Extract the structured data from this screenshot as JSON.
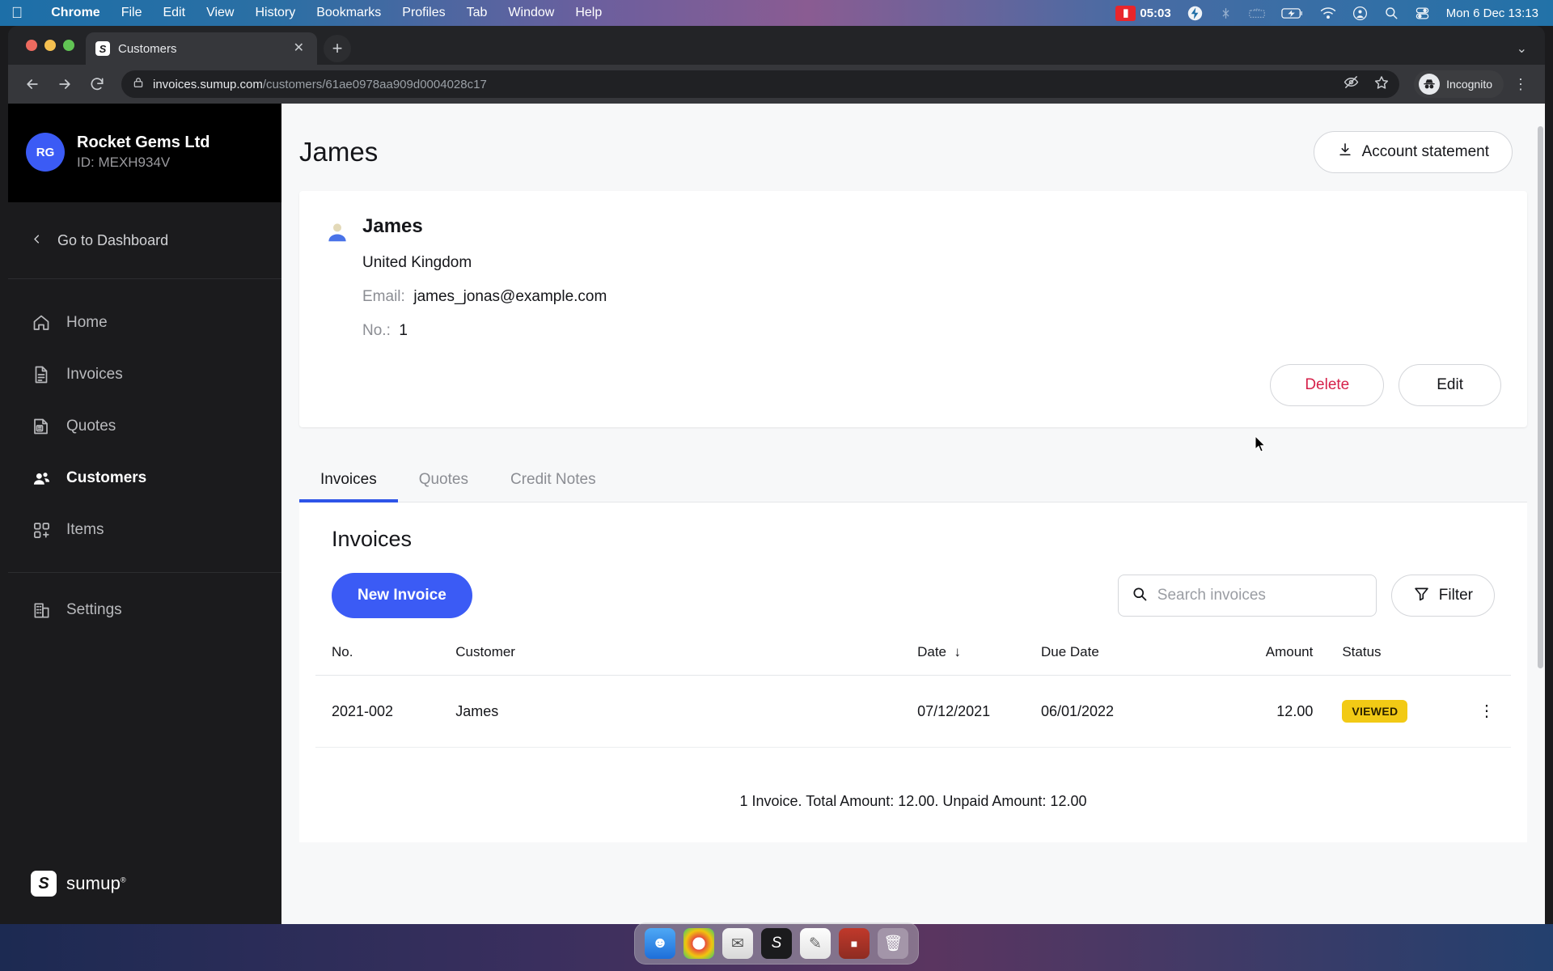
{
  "menubar": {
    "apple_icon": "apple-icon",
    "items": [
      {
        "label": "Chrome",
        "bold": true
      },
      {
        "label": "File",
        "bold": false
      },
      {
        "label": "Edit",
        "bold": false
      },
      {
        "label": "View",
        "bold": false
      },
      {
        "label": "History",
        "bold": false
      },
      {
        "label": "Bookmarks",
        "bold": false
      },
      {
        "label": "Profiles",
        "bold": false
      },
      {
        "label": "Tab",
        "bold": false
      },
      {
        "label": "Window",
        "bold": false
      },
      {
        "label": "Help",
        "bold": false
      }
    ],
    "recording_time": "05:03",
    "status_icons": [
      "screen-record-icon",
      "bolt-icon",
      "bluetooth-off-icon",
      "keyboard-brightness-icon",
      "battery-charging-icon",
      "wifi-icon",
      "control-center-user-icon",
      "search-icon",
      "control-center-icon"
    ],
    "clock": "Mon 6 Dec  13:13"
  },
  "browser": {
    "tab": {
      "title": "Customers",
      "favicon": "sumup-favicon",
      "close_icon": "close-icon"
    },
    "new_tab_icon": "plus-icon",
    "window_chevron_icon": "chevron-down-icon",
    "nav": {
      "back_icon": "back-arrow-icon",
      "forward_icon": "forward-arrow-icon",
      "reload_icon": "reload-icon"
    },
    "omnibox": {
      "lock_icon": "lock-icon",
      "domain": "invoices.sumup.com",
      "path": "/customers/61ae0978aa909d0004028c17",
      "eye_icon": "eye-off-icon",
      "bookmark_icon": "star-icon"
    },
    "profile": {
      "label": "Incognito",
      "icon": "incognito-icon"
    },
    "menu_icon": "kebab-menu-icon"
  },
  "sidebar": {
    "org": {
      "initials": "RG",
      "name": "Rocket Gems Ltd",
      "id": "ID: MEXH934V"
    },
    "go_to_dashboard": {
      "label": "Go to Dashboard",
      "icon": "chevron-left-icon"
    },
    "items": [
      {
        "label": "Home",
        "icon": "home-icon",
        "active": false
      },
      {
        "label": "Invoices",
        "icon": "invoice-document-icon",
        "active": false
      },
      {
        "label": "Quotes",
        "icon": "quote-document-icon",
        "active": false
      },
      {
        "label": "Customers",
        "icon": "customers-people-icon",
        "active": true
      },
      {
        "label": "Items",
        "icon": "items-grid-icon",
        "active": false
      }
    ],
    "settings": {
      "label": "Settings",
      "icon": "building-settings-icon"
    },
    "brand": {
      "name": "sumup",
      "registered": "®",
      "icon": "sumup-logo-icon"
    }
  },
  "main": {
    "page_title": "James",
    "account_statement_button": {
      "label": "Account statement",
      "icon": "download-icon"
    },
    "customer": {
      "avatar_icon": "person-avatar-icon",
      "name": "James",
      "country": "United Kingdom",
      "email_label": "Email:",
      "email_value": "james_jonas@example.com",
      "no_label": "No.:",
      "no_value": "1",
      "delete_button": "Delete",
      "edit_button": "Edit"
    },
    "tabs": [
      {
        "label": "Invoices",
        "active": true
      },
      {
        "label": "Quotes",
        "active": false
      },
      {
        "label": "Credit Notes",
        "active": false
      }
    ],
    "invoices": {
      "section_title": "Invoices",
      "new_invoice_button": "New Invoice",
      "search_placeholder": "Search invoices",
      "search_value": "",
      "search_icon": "search-icon",
      "filter_button": {
        "label": "Filter",
        "icon": "filter-funnel-icon"
      },
      "columns": [
        "No.",
        "Customer",
        "Date",
        "Due Date",
        "Amount",
        "Status"
      ],
      "sort_column": "Date",
      "sort_icon": "arrow-down-icon",
      "rows": [
        {
          "no": "2021-002",
          "customer": "James",
          "date": "07/12/2021",
          "due_date": "06/01/2022",
          "amount": "12.00",
          "status": "VIEWED",
          "row_menu_icon": "kebab-menu-icon"
        }
      ],
      "summary": "1 Invoice. Total Amount: 12.00. Unpaid Amount: 12.00"
    }
  },
  "dock": {
    "items": [
      "finder-icon",
      "chrome-icon",
      "mail-icon",
      "sumup-icon",
      "notes-icon",
      "terminal-icon",
      "trash-icon"
    ]
  },
  "colors": {
    "accent_blue": "#3b5bf5",
    "tab_underline": "#2e54e8",
    "delete_red": "#d6214a",
    "status_yellow": "#f2ca15",
    "sidebar_bg": "#1b1b1d",
    "page_bg": "#f7f8f9"
  }
}
